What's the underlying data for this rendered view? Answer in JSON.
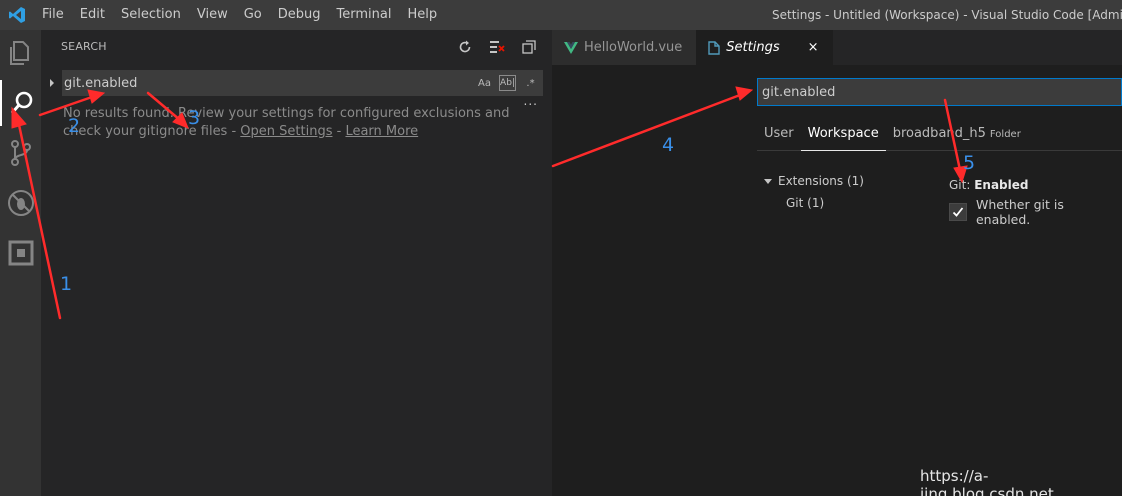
{
  "menu": [
    "File",
    "Edit",
    "Selection",
    "View",
    "Go",
    "Debug",
    "Terminal",
    "Help"
  ],
  "window_title": "Settings - Untitled (Workspace) - Visual Studio Code [Administrator]",
  "activity": [
    "explorer-icon",
    "search-icon",
    "source-control-icon",
    "debug-icon",
    "extensions-icon"
  ],
  "sidebar": {
    "title": "SEARCH",
    "search_value": "git.enabled",
    "case_option": "Aa",
    "word_option": "Ab|",
    "regex_option": ".*",
    "more": "...",
    "no_results_text": "No results found. Review your settings for configured exclusions and check your gitignore files - ",
    "open_settings": "Open Settings",
    "separator": " - ",
    "learn_more": "Learn More"
  },
  "editor": {
    "tabs": [
      {
        "label": "HelloWorld.vue",
        "icon": "vue-icon"
      },
      {
        "label": "Settings",
        "icon": "file-icon",
        "close": "×"
      }
    ],
    "settings_search_value": "git.enabled",
    "scope_tabs": [
      "User",
      "Workspace",
      "broadband_h5"
    ],
    "folder_label": "Folder",
    "toc": {
      "group": "Extensions (1)",
      "child": "Git (1)"
    },
    "setting": {
      "category": "Git: ",
      "name": "Enabled",
      "description": "Whether git is enabled.",
      "checked": true
    }
  },
  "annotations": [
    "1",
    "2",
    "3",
    "4",
    "5"
  ],
  "watermark": "https://a-jing.blog.csdn.net",
  "colors": {
    "accent": "#007acc",
    "arrow": "#ff2b2b",
    "number": "#3a8fe8"
  }
}
